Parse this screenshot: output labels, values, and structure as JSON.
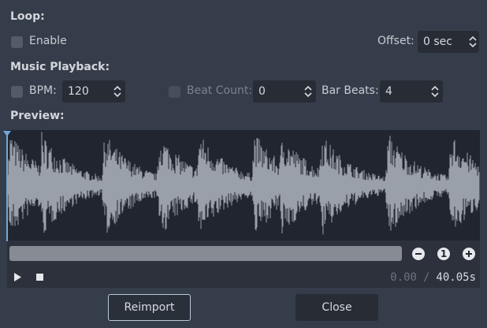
{
  "loop": {
    "title": "Loop:",
    "enable_label": "Enable",
    "offset_label": "Offset:",
    "offset_value": "0 sec"
  },
  "music": {
    "title": "Music Playback:",
    "bpm_label": "BPM:",
    "bpm_value": "120",
    "beat_count_label": "Beat Count:",
    "beat_count_value": "0",
    "bar_beats_label": "Bar Beats:",
    "bar_beats_value": "4"
  },
  "preview": {
    "title": "Preview:",
    "current_time": "0.00",
    "separator": "/",
    "total_time": "40.05s",
    "zoom_reset_label": "1"
  },
  "buttons": {
    "reimport": "Reimport",
    "close": "Close"
  },
  "colors": {
    "background": "#363d4a",
    "waveform": "#9aa0a9",
    "playhead": "#6fa8dc",
    "wave_bg": "#202530"
  }
}
